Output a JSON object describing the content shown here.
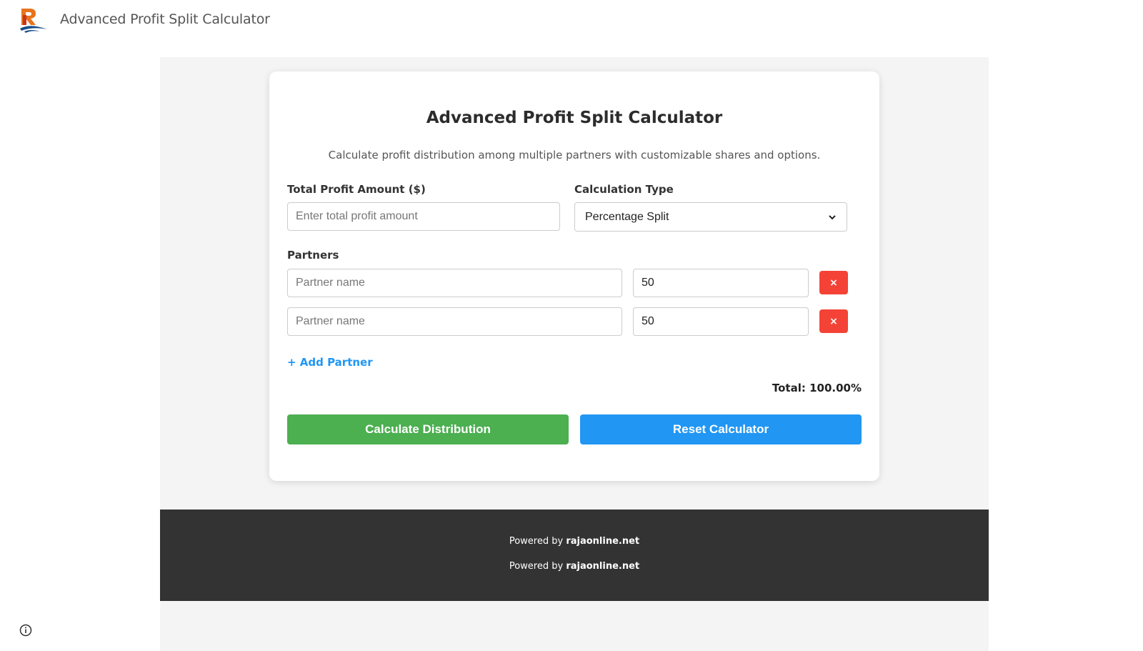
{
  "header": {
    "site_title": "Advanced Profit Split Calculator",
    "logo_icon": "rajaonline-logo-icon"
  },
  "card": {
    "title": "Advanced Profit Split Calculator",
    "description": "Calculate profit distribution among multiple partners with customizable shares and options.",
    "total_profit": {
      "label": "Total Profit Amount ($)",
      "value": "",
      "placeholder": "Enter total profit amount"
    },
    "calc_type": {
      "label": "Calculation Type",
      "selected": "Percentage Split"
    },
    "partners_label": "Partners",
    "partners": [
      {
        "name": "",
        "name_placeholder": "Partner name",
        "share": "50",
        "remove_label": "×"
      },
      {
        "name": "",
        "name_placeholder": "Partner name",
        "share": "50",
        "remove_label": "×"
      }
    ],
    "add_partner_label": "+ Add Partner",
    "total_label": "Total: 100.00%",
    "calculate_label": "Calculate Distribution",
    "reset_label": "Reset Calculator"
  },
  "footer": {
    "line1_prefix": "Powered by ",
    "line1_brand": "rajaonline.net",
    "line2_prefix": "Powered by ",
    "line2_brand": "rajaonline.net"
  },
  "colors": {
    "calculate_button": "#4caf50",
    "reset_button": "#2196f3",
    "remove_button": "#f44336",
    "add_partner_link": "#2196f3",
    "footer_background": "#333333",
    "page_background": "#f4f4f4"
  },
  "icons": {
    "remove": "close-icon",
    "dropdown": "chevron-down-icon",
    "info": "info-icon"
  }
}
